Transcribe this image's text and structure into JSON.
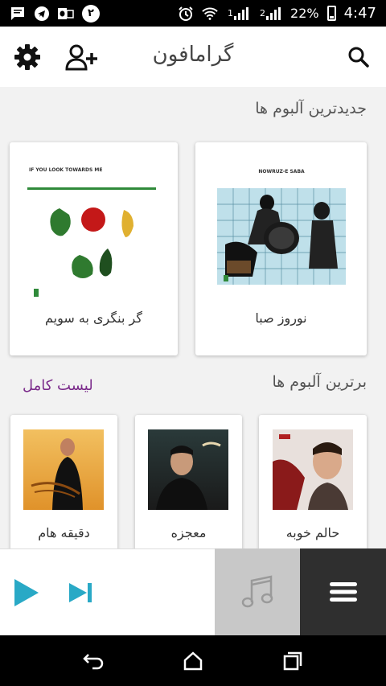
{
  "status": {
    "badge_number": "۲",
    "signal_1": "1",
    "signal_2": "2",
    "battery": "22%",
    "time": "4:47"
  },
  "header": {
    "title": "گرامافون"
  },
  "newest": {
    "title": "جدیدترین آلبوم ها",
    "albums": [
      {
        "title": "نوروز صبا",
        "cover_caption": "NOWRUZ-E SABA"
      },
      {
        "title": "گر بنگری به سویم",
        "cover_caption": "IF YOU LOOK TOWARDS ME"
      }
    ]
  },
  "top": {
    "title": "برترین آلبوم ها",
    "full_list": "لیست کامل",
    "albums": [
      {
        "title": "حالم خوبه"
      },
      {
        "title": "معجزه"
      },
      {
        "title": "دقیقه هام"
      }
    ]
  },
  "colors": {
    "accent": "#7a2a8a",
    "play": "#29a9c6",
    "player_art_bg": "#c8c8c8",
    "player_menu_bg": "#2f2f2f"
  },
  "icons": {
    "settings": "gear-icon",
    "add_user": "add-user-icon",
    "search": "search-icon",
    "play": "play-icon",
    "next": "skip-next-icon",
    "music": "music-note-icon",
    "menu": "hamburger-icon"
  }
}
